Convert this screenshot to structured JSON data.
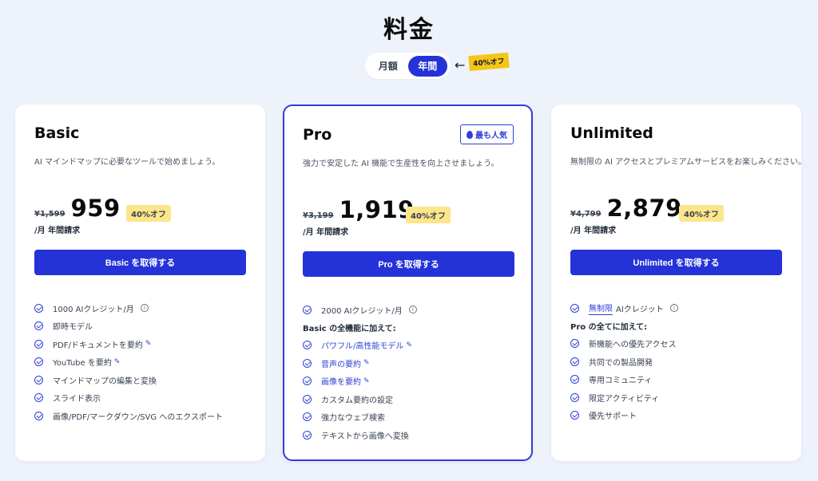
{
  "page": {
    "title": "料金"
  },
  "toggle": {
    "monthly": "月額",
    "yearly": "年間",
    "discount": "40%オフ",
    "arrow": "←"
  },
  "plans": {
    "basic": {
      "name": "Basic",
      "desc": "AI マインドマップに必要なツールで始めましょう。",
      "old_price": "¥1,599",
      "price": "959",
      "off": "40%オフ",
      "period": "/月 年間請求",
      "cta": "Basic を取得する",
      "features": [
        "1000 AIクレジット/月",
        "即時モデル",
        "PDF/ドキュメントを要約",
        "YouTube を要約",
        "マインドマップの編集と変換",
        "スライド表示",
        "画像/PDF/マークダウン/SVG へのエクスポート"
      ]
    },
    "pro": {
      "name": "Pro",
      "badge": "最も人気",
      "desc": "強力で安定した AI 機能で生産性を向上させましょう。",
      "old_price": "¥3,199",
      "price": "1,919",
      "off": "40%オフ",
      "period": "/月 年間請求",
      "cta": "Pro を取得する",
      "credits": "2000 AIクレジット/月",
      "section": "Basic の全機能に加えて:",
      "features": [
        "パワフル/高性能モデル",
        "音声の要約",
        "画像を要約",
        "カスタム要約の設定",
        "強力なウェブ検索",
        "テキストから画像へ変換"
      ]
    },
    "unlimited": {
      "name": "Unlimited",
      "desc": "無制限の AI アクセスとプレミアムサービスをお楽しみください。",
      "old_price": "¥4,799",
      "price": "2,879",
      "off": "40%オフ",
      "period": "/月 年間請求",
      "cta": "Unlimited を取得する",
      "credits_highlight": "無制限",
      "credits_rest": "AIクレジット",
      "section": "Pro の全てに加えて:",
      "features": [
        "新機能への優先アクセス",
        "共同での製品開発",
        "専用コミュニティ",
        "限定アクティビティ",
        "優先サポート"
      ]
    }
  },
  "icons": {
    "check": "check-circle-icon",
    "info": "info-icon",
    "spark": "sparkle-icon",
    "flame": "flame-icon"
  },
  "colors": {
    "accent": "#2432d8",
    "badge": "#fde68a",
    "tag": "#f5c518",
    "background": "#eef2fb"
  }
}
